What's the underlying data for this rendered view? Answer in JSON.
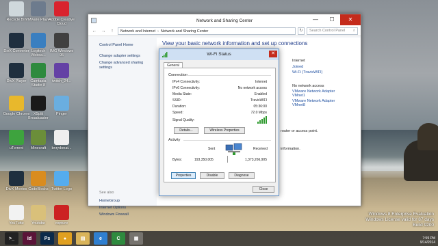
{
  "desktop": {
    "icons": [
      {
        "label": "Recycle Bin",
        "color": "#cfd8dc"
      },
      {
        "label": "VMware Player",
        "color": "#6d7b8d"
      },
      {
        "label": "Adobe Creative Cloud",
        "color": "#d9232e"
      },
      {
        "label": "DivX Converter",
        "color": "#1f2f3f"
      },
      {
        "label": "Logitech Webca...",
        "color": "#3a7fc0"
      },
      {
        "label": "IMG Windows 95",
        "color": "#404040"
      },
      {
        "label": "DivX Player",
        "color": "#1f2f3f"
      },
      {
        "label": "Camtasia Studio 8",
        "color": "#2e8a3e"
      },
      {
        "label": "twitch_24...",
        "color": "#6441a5"
      },
      {
        "label": "Google Chrome",
        "color": "#e8b82c"
      },
      {
        "label": "XSplit Broadcaster",
        "color": "#1a1a1a"
      },
      {
        "label": "Pinger",
        "color": "#6aaee0"
      },
      {
        "label": "uTorrent",
        "color": "#3ea33e"
      },
      {
        "label": "Minecraft",
        "color": "#6b8e3a"
      },
      {
        "label": "bnrydonat...",
        "color": "#eeeeee"
      },
      {
        "label": "DivX Movies",
        "color": "#1f2f3f"
      },
      {
        "label": "CodeBlocks",
        "color": "#d98c1f"
      },
      {
        "label": "Twitter Logo",
        "color": "#55acee"
      },
      {
        "label": "YouTube",
        "color": "#f2f2f2"
      },
      {
        "label": "Youtube",
        "color": "#d9c07a"
      },
      {
        "label": "capture",
        "color": "#cc2222"
      }
    ],
    "watermark": [
      "Windows 8 Enterprise Evaluation",
      "Windows License valid for 87 days",
      "Build 9200"
    ]
  },
  "window": {
    "title": "Network and Sharing Center",
    "min": "—",
    "max": "☐",
    "close": "✕",
    "back": "←",
    "forward": "→",
    "up": "↑",
    "breadcrumb": [
      "Network and Internet",
      "Network and Sharing Center"
    ],
    "breadcrumb_sep": "›",
    "refresh": "↻",
    "search_placeholder": "Search Control Panel",
    "search_icon": "⌕",
    "left_links": [
      "Control Panel Home",
      "Change adapter settings",
      "Change advanced sharing settings"
    ],
    "see_also": "See also",
    "see_also_links": [
      "HomeGroup",
      "Internet Options",
      "Windows Firewall"
    ],
    "heading": "View your basic network information and set up connections",
    "right_texts": {
      "internet": "Internet",
      "joined": "Joined",
      "wifi": "Wi-Fi (TravisWIFI)",
      "no_internet": "No network access",
      "vmnet1": "VMware Network Adapter VMnet1",
      "vmnet8": "VMware Network Adapter VMnet8",
      "router": "router or access point.",
      "info": "information."
    }
  },
  "dialog": {
    "title": "Wi-Fi Status",
    "close": "✕",
    "tab": "General",
    "connection_label": "Connection",
    "rows": [
      {
        "k": "IPv4 Connectivity:",
        "v": "Internet"
      },
      {
        "k": "IPv6 Connectivity:",
        "v": "No network access"
      },
      {
        "k": "Media State:",
        "v": "Enabled"
      },
      {
        "k": "SSID:",
        "v": "TravisWIFI"
      },
      {
        "k": "Duration:",
        "v": "05:36:00"
      },
      {
        "k": "Speed:",
        "v": "72.0 Mbps"
      }
    ],
    "signal_label": "Signal Quality:",
    "details": "Details...",
    "wireless_props": "Wireless Properties",
    "activity_label": "Activity",
    "sent_label": "Sent",
    "received_label": "Received",
    "bytes_label": "Bytes:",
    "bytes_sent": "193,350,005",
    "bytes_received": "1,373,266,905",
    "properties": "Properties",
    "disable": "Disable",
    "diagnose": "Diagnose",
    "close_btn": "Close"
  },
  "taskbar": {
    "items": [
      {
        "name": "cmd",
        "glyph": ">_",
        "color": "#222222"
      },
      {
        "name": "indesign",
        "glyph": "Id",
        "color": "#5a1438"
      },
      {
        "name": "photoshop",
        "glyph": "Ps",
        "color": "#0b2a4a"
      },
      {
        "name": "chrome",
        "glyph": "●",
        "color": "#e0a020"
      },
      {
        "name": "explorer",
        "glyph": "▤",
        "color": "#d9b45a"
      },
      {
        "name": "ie",
        "glyph": "e",
        "color": "#2f7fd0"
      },
      {
        "name": "camtasia",
        "glyph": "C",
        "color": "#2e8a3e"
      },
      {
        "name": "network",
        "glyph": "▦",
        "color": "#6aaee0",
        "active": true
      }
    ],
    "time": "7:59 PM",
    "date": "9/14/2014"
  }
}
